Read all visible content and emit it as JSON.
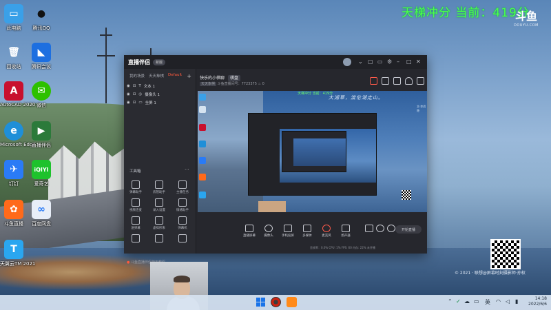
{
  "stream_overlay": {
    "title": "天梯冲分 当前：419分",
    "logo_mark": "斗鱼",
    "logo_sub": "DOUYU.COM",
    "qr_caption": "© 2021 · 联想@屏幕时刻摄影师·孙权"
  },
  "desktop_icons": [
    {
      "label": "此电脑",
      "glyph": "▭",
      "color": "#3aa0e8"
    },
    {
      "label": "回收站",
      "glyph": "🗑",
      "color": "#d6e3f0"
    },
    {
      "label": "AutoCAD 2020",
      "glyph": "A",
      "color": "#c8102e"
    },
    {
      "label": "Microsoft Edge",
      "glyph": "e",
      "color": "#1f8fd8"
    },
    {
      "label": "钉钉",
      "glyph": "✈",
      "color": "#2a7bf6"
    },
    {
      "label": "斗鱼直播",
      "glyph": "✿",
      "color": "#ff6a1a"
    },
    {
      "label": "天翼云TM 2021",
      "glyph": "T",
      "color": "#2aa6f0"
    },
    {
      "label": "腾讯QQ",
      "glyph": "●",
      "color": "#202020"
    },
    {
      "label": "腾讯会议",
      "glyph": "◣",
      "color": "#1d6fe0"
    },
    {
      "label": "微信",
      "glyph": "✉",
      "color": "#2dc100"
    },
    {
      "label": "直播伴侣",
      "glyph": "▶",
      "color": "#2b7a3a"
    },
    {
      "label": "爱奇艺",
      "glyph": "iQIYI",
      "color": "#1ec22c"
    },
    {
      "label": "百度网盘",
      "glyph": "∞",
      "color": "#e8eef8"
    }
  ],
  "window": {
    "app_name": "直播伴侣",
    "version_pill": "新版",
    "sidebar_tabs": [
      "我的场景",
      "天天象棋",
      "Default"
    ],
    "layers": [
      "文本 1",
      "摄像头 1",
      "全屏 1"
    ],
    "tools_header": "工具箱",
    "tools": [
      "弹幕助手",
      "房管助手",
      "主播任务",
      "视频连麦",
      "录入设置",
      "情绪助手",
      "送弹幕",
      "虚拟形象",
      "弹幕机",
      "",
      "",
      ""
    ],
    "footer_note": "斗鱼直播伴侣使用教程",
    "live_title": "快乐的小棋聊",
    "live_badge": "棋盘",
    "live_sub_tag": "天天象棋",
    "live_sub_text": "斗鱼直播间号：7723375",
    "live_sub_count": "0",
    "preview_text": "大湖草，渡伦湖走山。",
    "preview_text2": "文·李尚隐",
    "preview_green": "天梯冲分 当前：419分",
    "controls": [
      "直播屏幕",
      "摄像头",
      "手机投屏",
      "多媒体",
      "麦克风",
      "扬声器"
    ],
    "start_label": "开始直播",
    "stats": "丢帧率：0.0%   CPU: 1%   FPS: 60   内存: 22%   未开播"
  },
  "taskbar": {
    "tray_lang": "英",
    "time": "14:18",
    "date": "2022/6/6"
  }
}
